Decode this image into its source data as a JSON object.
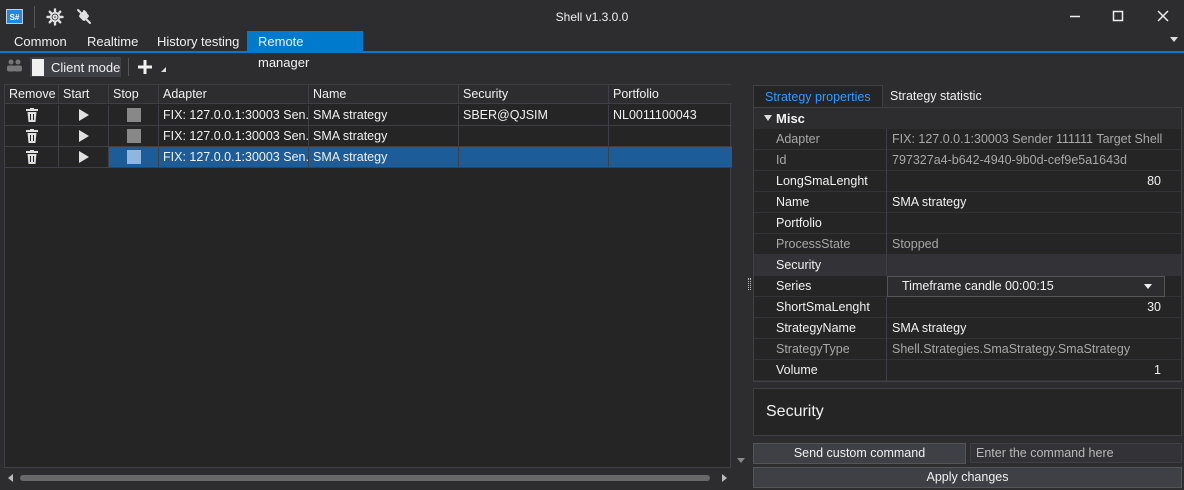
{
  "window": {
    "title": "Shell v1.3.0.0",
    "logo_text": "S#",
    "icons": [
      "settings-gear-icon",
      "disconnect-plug-icon"
    ]
  },
  "tabs": [
    "Common",
    "Realtime",
    "History testing",
    "Remote manager"
  ],
  "active_tab": "Remote manager",
  "toolbar": {
    "client_mode_label": "Client mode",
    "add_icon": "plus-icon"
  },
  "grid": {
    "columns": [
      "Remove",
      "Start",
      "Stop",
      "Adapter",
      "Name",
      "Security",
      "Portfolio"
    ],
    "rows": [
      {
        "adapter": "FIX: 127.0.0.1:30003 Sen...",
        "name": "SMA strategy",
        "security": "SBER@QJSIM",
        "portfolio": "NL0011100043"
      },
      {
        "adapter": "FIX: 127.0.0.1:30003 Sen...",
        "name": "SMA strategy",
        "security": "",
        "portfolio": ""
      },
      {
        "adapter": "FIX: 127.0.0.1:30003 Sen...",
        "name": "SMA strategy",
        "security": "",
        "portfolio": ""
      }
    ],
    "selected_row": 3
  },
  "right_panel": {
    "tabs": [
      "Strategy properties",
      "Strategy statistic"
    ],
    "active_tab": "Strategy properties",
    "category": "Misc",
    "properties": [
      {
        "name": "Adapter",
        "value": "FIX: 127.0.0.1:30003 Sender 111111 Target Shell"
      },
      {
        "name": "Id",
        "value": "797327a4-b642-4940-9b0d-cef9e5a1643d"
      },
      {
        "name": "LongSmaLenght",
        "value": "80"
      },
      {
        "name": "Name",
        "value": "SMA strategy"
      },
      {
        "name": "Portfolio",
        "value": ""
      },
      {
        "name": "ProcessState",
        "value": "Stopped"
      },
      {
        "name": "Security",
        "value": ""
      },
      {
        "name": "Series",
        "value": "Timeframe candle 00:00:15"
      },
      {
        "name": "ShortSmaLenght",
        "value": "30"
      },
      {
        "name": "StrategyName",
        "value": "SMA strategy"
      },
      {
        "name": "StrategyType",
        "value": "Shell.Strategies.SmaStrategy.SmaStrategy"
      },
      {
        "name": "Volume",
        "value": "1"
      }
    ],
    "description_title": "Security",
    "send_command_label": "Send custom command",
    "command_placeholder": "Enter the command here",
    "apply_label": "Apply changes"
  },
  "colors": {
    "accent": "#007acc",
    "background": "#2d2d30",
    "panel": "#252526",
    "selected_row": "#1c5d99",
    "link_tab": "#3399ff"
  }
}
